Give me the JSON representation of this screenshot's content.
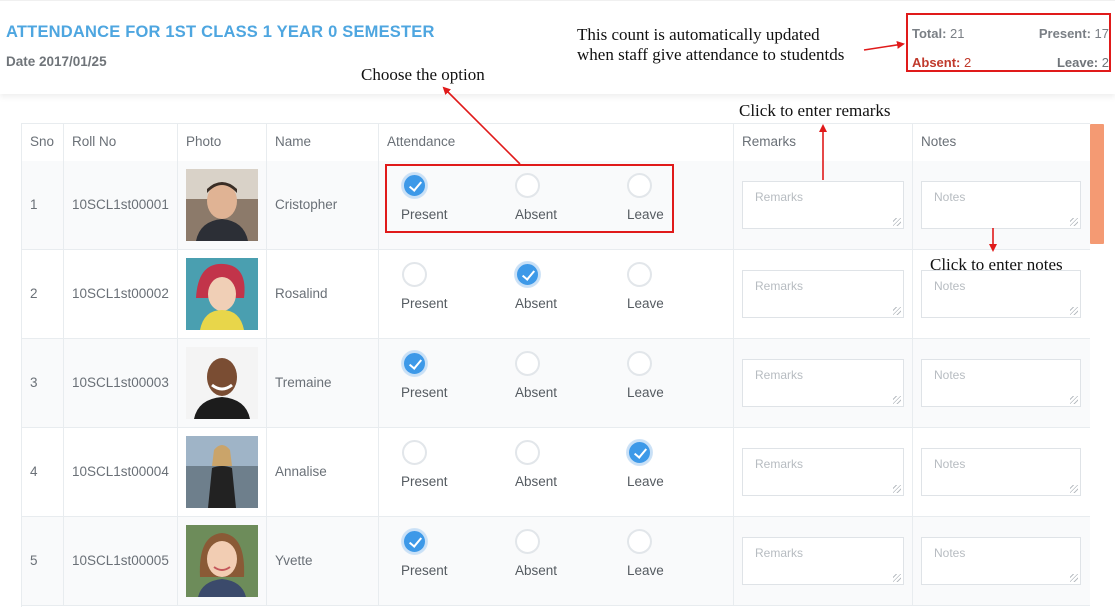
{
  "header": {
    "title": "ATTENDANCE FOR 1ST CLASS 1 YEAR 0 SEMESTER",
    "date": "Date 2017/01/25"
  },
  "counts": {
    "total_label": "Total:",
    "total": "21",
    "present_label": "Present:",
    "present": "17",
    "absent_label": "Absent:",
    "absent": "2",
    "leave_label": "Leave:",
    "leave": "2",
    "absent_color": "#c0392b"
  },
  "annotations": {
    "count_note_line1": "This count is automatically updated",
    "count_note_line2": "when staff give attendance to studentds",
    "choose_option": "Choose the option",
    "enter_remarks": "Click to enter remarks",
    "enter_notes": "Click to enter notes",
    "annotation_color": "#e01a1a"
  },
  "table": {
    "columns": [
      "Sno",
      "Roll No",
      "Photo",
      "Name",
      "Attendance",
      "Remarks",
      "Notes"
    ],
    "option_labels": [
      "Present",
      "Absent",
      "Leave"
    ],
    "remarks_placeholder": "Remarks",
    "notes_placeholder": "Notes",
    "checked_color": "#3d99e8",
    "rows": [
      {
        "sno": "1",
        "roll": "10SCL1st00001",
        "name": "Cristopher",
        "attendance": "Present"
      },
      {
        "sno": "2",
        "roll": "10SCL1st00002",
        "name": "Rosalind",
        "attendance": "Absent"
      },
      {
        "sno": "3",
        "roll": "10SCL1st00003",
        "name": "Tremaine",
        "attendance": "Present"
      },
      {
        "sno": "4",
        "roll": "10SCL1st00004",
        "name": "Annalise",
        "attendance": "Leave"
      },
      {
        "sno": "5",
        "roll": "10SCL1st00005",
        "name": "Yvette",
        "attendance": "Present"
      }
    ]
  },
  "scrollbar_color": "#f49a73"
}
